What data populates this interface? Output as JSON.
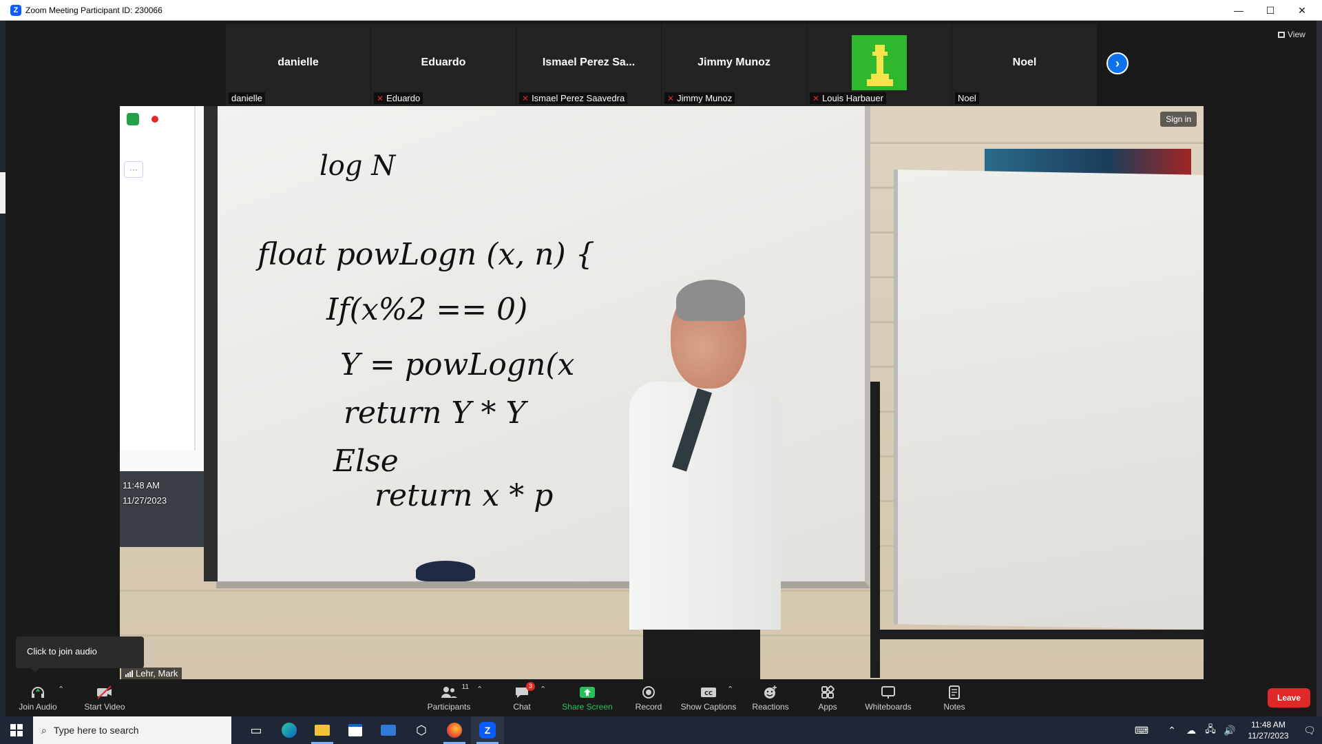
{
  "window": {
    "title": "Zoom Meeting Participant ID: 230066",
    "minimize": "—",
    "maximize": "☐",
    "close": "✕"
  },
  "participants": [
    {
      "display": "danielle",
      "tag": "danielle",
      "muted": false
    },
    {
      "display": "Eduardo",
      "tag": "Eduardo",
      "muted": true
    },
    {
      "display": "Ismael Perez Sa...",
      "tag": "Ismael Perez Saavedra",
      "muted": true
    },
    {
      "display": "Jimmy Munoz",
      "tag": "Jimmy Munoz",
      "muted": true
    },
    {
      "display": "",
      "tag": "Louis Harbauer",
      "muted": true
    },
    {
      "display": "Noel",
      "tag": "Noel",
      "muted": false
    }
  ],
  "view_label": "View",
  "next_icon": "›",
  "video": {
    "sign_in": "Sign in",
    "speaker_name": "Lehr, Mark",
    "screen_time": "11:48 AM",
    "screen_date": "11/27/2023",
    "board_lines": [
      "log N",
      "float powLogn (x, n) {",
      "If(x%2 == 0)",
      "Y = powLogn(x",
      "return Y * Y",
      "Else",
      "return x * p"
    ]
  },
  "tooltip": "Click to join audio",
  "toolbar": {
    "join_audio": "Join Audio",
    "start_video": "Start Video",
    "participants": "Participants",
    "participants_count": "11",
    "chat": "Chat",
    "chat_badge": "3",
    "share_screen": "Share Screen",
    "record": "Record",
    "show_captions": "Show Captions",
    "reactions": "Reactions",
    "apps": "Apps",
    "whiteboards": "Whiteboards",
    "notes": "Notes",
    "leave": "Leave"
  },
  "taskbar": {
    "search_placeholder": "Type here to search",
    "time": "11:48 AM",
    "date": "11/27/2023"
  },
  "colors": {
    "accent_blue": "#0e72ed",
    "leave_red": "#e02828",
    "share_green": "#2bbf5a"
  }
}
